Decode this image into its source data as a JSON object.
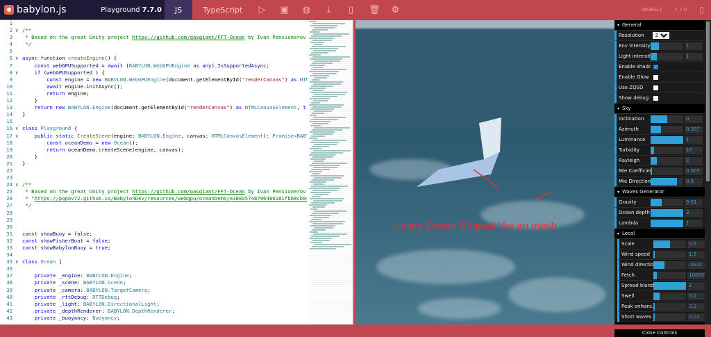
{
  "header": {
    "brand": "babylon.js",
    "playground_label": "Playground",
    "version": "7.7.0",
    "tab_js": "JS",
    "tab_ts": "TypeScript",
    "engine": "WEBGL2",
    "engine_version": "7.7.0",
    "icons": [
      "play-icon",
      "save-icon",
      "snippet-icon",
      "download-icon",
      "new-file-icon",
      "delete-icon",
      "settings-icon"
    ]
  },
  "editor": {
    "lines": [
      [],
      [
        [
          "c",
          "/**"
        ]
      ],
      [
        [
          "c",
          " * Based on the great Unity project "
        ],
        [
          "u",
          "https://github.com/gasgiant/FFT-Ocean"
        ],
        [
          "c",
          " by Ivan Pensionerov ("
        ],
        [
          "u",
          "https"
        ]
      ],
      [
        [
          "c",
          " */"
        ]
      ],
      [],
      [
        [
          "k",
          "async function "
        ],
        [
          "f",
          "createEngine"
        ],
        [
          "",
          "() {"
        ]
      ],
      [
        [
          "",
          "    "
        ],
        [
          "k",
          "const "
        ],
        [
          "v",
          "webGPUSupported"
        ],
        [
          "",
          " = "
        ],
        [
          "k",
          "await "
        ],
        [
          "",
          "("
        ],
        [
          "t",
          "BABYLON.WebGPUEngine"
        ],
        [
          "k",
          " as any"
        ],
        [
          "",
          ")."
        ],
        [
          "v",
          "IsSupportedAsync"
        ],
        [
          "",
          ";"
        ]
      ],
      [
        [
          "",
          "    "
        ],
        [
          "k",
          "if "
        ],
        [
          "",
          "("
        ],
        [
          "v",
          "webGPUSupported"
        ],
        [
          "",
          " ) {"
        ]
      ],
      [
        [
          "",
          "        "
        ],
        [
          "k",
          "const "
        ],
        [
          "v",
          "engine"
        ],
        [
          "",
          " = "
        ],
        [
          "k",
          "new "
        ],
        [
          "t",
          "BABYLON.WebGPUEngine"
        ],
        [
          "",
          "(document.getElementById("
        ],
        [
          "s",
          "\"renderCanvas\""
        ],
        [
          "",
          ") "
        ],
        [
          "k",
          "as "
        ],
        [
          "t",
          "HTMLCanva"
        ]
      ],
      [
        [
          "",
          "        "
        ],
        [
          "k",
          "await "
        ],
        [
          "",
          "engine.initAsync();"
        ]
      ],
      [
        [
          "",
          "        "
        ],
        [
          "k",
          "return "
        ],
        [
          "",
          "engine;"
        ]
      ],
      [
        [
          "",
          "    }"
        ]
      ],
      [
        [
          "",
          "    "
        ],
        [
          "k",
          "return new "
        ],
        [
          "t",
          "BABYLON.Engine"
        ],
        [
          "",
          "(document.getElementById("
        ],
        [
          "s",
          "\"renderCanvas\""
        ],
        [
          "",
          ") "
        ],
        [
          "k",
          "as "
        ],
        [
          "t",
          "HTMLCanvasElement"
        ],
        [
          "",
          ", "
        ],
        [
          "k",
          "true"
        ],
        [
          "",
          ");"
        ]
      ],
      [
        [
          "",
          "}"
        ]
      ],
      [],
      [
        [
          "k",
          "class "
        ],
        [
          "t",
          "Playground"
        ],
        [
          "",
          " {"
        ]
      ],
      [
        [
          "",
          "    "
        ],
        [
          "k",
          "public static "
        ],
        [
          "f",
          "CreateScene"
        ],
        [
          "",
          "(engine: "
        ],
        [
          "t",
          "BABYLON.Engine"
        ],
        [
          "",
          ", canvas: "
        ],
        [
          "t",
          "HTMLCanvasElement"
        ],
        [
          "",
          "): "
        ],
        [
          "t",
          "Promise<BABYLON.Sc"
        ]
      ],
      [
        [
          "",
          "        "
        ],
        [
          "k",
          "const "
        ],
        [
          "v",
          "oceanDemo"
        ],
        [
          "",
          " = "
        ],
        [
          "k",
          "new "
        ],
        [
          "t",
          "Ocean"
        ],
        [
          "",
          "();"
        ]
      ],
      [
        [
          "",
          "        "
        ],
        [
          "k",
          "return "
        ],
        [
          "",
          "oceanDemo.createScene(engine, canvas);"
        ]
      ],
      [
        [
          "",
          "    }"
        ]
      ],
      [
        [
          "",
          "}"
        ]
      ],
      [],
      [],
      [
        [
          "c",
          "/**"
        ]
      ],
      [
        [
          "c",
          " * Based on the great Unity project "
        ],
        [
          "u",
          "https://github.com/gasgiant/FFT-Ocean"
        ],
        [
          "c",
          " by Ivan Pensionerov ("
        ],
        [
          "u",
          "https"
        ]
      ],
      [
        [
          "c",
          " * \""
        ],
        [
          "u",
          "https://popov72.github.io/BabylonDev/resources/webgpu/oceanDemo/e388a5748796486181fbb8cb94bd0a66"
        ]
      ],
      [
        [
          "c",
          " */"
        ]
      ],
      [],
      [],
      [],
      [
        [
          "k",
          "const "
        ],
        [
          "v",
          "showBuoy"
        ],
        [
          "",
          " = "
        ],
        [
          "k",
          "false"
        ],
        [
          "",
          ";"
        ]
      ],
      [
        [
          "k",
          "const "
        ],
        [
          "v",
          "showFisherBoat"
        ],
        [
          "",
          " = "
        ],
        [
          "k",
          "false"
        ],
        [
          "",
          ";"
        ]
      ],
      [
        [
          "k",
          "const "
        ],
        [
          "v",
          "showBabylonBuoy"
        ],
        [
          "",
          " = "
        ],
        [
          "k",
          "true"
        ],
        [
          "",
          ";"
        ]
      ],
      [],
      [
        [
          "k",
          "class "
        ],
        [
          "t",
          "Ocean"
        ],
        [
          "",
          " {"
        ]
      ],
      [],
      [
        [
          "",
          "    "
        ],
        [
          "k",
          "private "
        ],
        [
          "v",
          "_engine"
        ],
        [
          "",
          ": "
        ],
        [
          "t",
          "BABYLON.Engine"
        ],
        [
          "",
          ";"
        ]
      ],
      [
        [
          "",
          "    "
        ],
        [
          "k",
          "private "
        ],
        [
          "v",
          "_scene"
        ],
        [
          "",
          ": "
        ],
        [
          "t",
          "BABYLON.Scene"
        ],
        [
          "",
          ";"
        ]
      ],
      [
        [
          "",
          "    "
        ],
        [
          "k",
          "private "
        ],
        [
          "v",
          "_camera"
        ],
        [
          "",
          ": "
        ],
        [
          "t",
          "BABYLON.TargetCamera"
        ],
        [
          "",
          ";"
        ]
      ],
      [
        [
          "",
          "    "
        ],
        [
          "k",
          "private "
        ],
        [
          "v",
          "_rttDebug"
        ],
        [
          "",
          ": "
        ],
        [
          "t",
          "RTTDebug"
        ],
        [
          "",
          ";"
        ]
      ],
      [
        [
          "",
          "    "
        ],
        [
          "k",
          "private "
        ],
        [
          "v",
          "_light"
        ],
        [
          "",
          ": "
        ],
        [
          "t",
          "BABYLON.DirectionalLight"
        ],
        [
          "",
          ";"
        ]
      ],
      [
        [
          "",
          "    "
        ],
        [
          "k",
          "private "
        ],
        [
          "v",
          "_depthRenderer"
        ],
        [
          "",
          ": "
        ],
        [
          "t",
          "BABYLON.DepthRenderer"
        ],
        [
          "",
          ";"
        ]
      ],
      [
        [
          "",
          "    "
        ],
        [
          "k",
          "private "
        ],
        [
          "v",
          "_buoyancy"
        ],
        [
          "",
          ": "
        ],
        [
          "t",
          "Buoyancy"
        ],
        [
          "",
          ";"
        ]
      ]
    ],
    "folds": [
      2,
      6,
      8,
      16,
      17,
      24,
      35
    ]
  },
  "viewport": {
    "annotation": "i want Ocean Shaped like an mesh",
    "annotation_color": "#e5303a"
  },
  "controls": {
    "sections": [
      {
        "title": "General",
        "rows": [
          {
            "label": "Resolution",
            "type": "select",
            "value": "256"
          },
          {
            "label": "Env intensity",
            "type": "slider",
            "value": "1",
            "fill": 0.25
          },
          {
            "label": "Light intensity",
            "type": "slider",
            "value": "1",
            "fill": 0.2
          },
          {
            "label": "Enable shadows",
            "type": "check",
            "checked": true
          },
          {
            "label": "Enable Glow",
            "type": "check",
            "checked": false
          },
          {
            "label": "Use ZQSD",
            "type": "check",
            "checked": false
          },
          {
            "label": "Show debug RTT",
            "type": "check",
            "checked": false
          }
        ]
      },
      {
        "title": "Sky",
        "rows": [
          {
            "label": "Inclination",
            "type": "slider",
            "value": "0",
            "fill": 0.5
          },
          {
            "label": "Azimuth",
            "type": "slider",
            "value": "0.307",
            "fill": 0.31
          },
          {
            "label": "Luminance",
            "type": "slider",
            "value": "1",
            "fill": 1
          },
          {
            "label": "Turbidity",
            "type": "slider",
            "value": "10",
            "fill": 0.1
          },
          {
            "label": "Rayleigh",
            "type": "slider",
            "value": "2",
            "fill": 0.2
          },
          {
            "label": "Mie Coefficient",
            "type": "slider",
            "value": "0.005",
            "fill": 0.03
          },
          {
            "label": "Mie Directional",
            "type": "slider",
            "value": "0.8",
            "fill": 0.8
          }
        ]
      },
      {
        "title": "Waves Generator",
        "rows": [
          {
            "label": "Gravity",
            "type": "slider",
            "value": "9.81",
            "fill": 0.33
          },
          {
            "label": "Ocean depth",
            "type": "slider",
            "value": "3",
            "fill": 1
          },
          {
            "label": "Lambda",
            "type": "slider",
            "value": "1",
            "fill": 1
          }
        ]
      },
      {
        "title": "Local",
        "local": true,
        "rows": [
          {
            "label": "Scale",
            "type": "slider",
            "value": "0.5",
            "fill": 0.5
          },
          {
            "label": "Wind speed",
            "type": "slider",
            "value": "1.5",
            "fill": 0.02
          },
          {
            "label": "Wind direction",
            "type": "slider",
            "value": "-29.8",
            "fill": 0.35
          },
          {
            "label": "Fetch",
            "type": "slider",
            "value": "100000",
            "fill": 0.1
          },
          {
            "label": "Spread blend",
            "type": "slider",
            "value": "1",
            "fill": 1
          },
          {
            "label": "Swell",
            "type": "slider",
            "value": "0.2",
            "fill": 0.2
          },
          {
            "label": "Peak enhanc.",
            "type": "slider",
            "value": "3.3",
            "fill": 0.03
          },
          {
            "label": "Short waves",
            "type": "slider",
            "value": "0.01",
            "fill": 0.01
          }
        ]
      },
      {
        "title": "Swell",
        "rows": []
      }
    ],
    "close_label": "Close Controls"
  }
}
